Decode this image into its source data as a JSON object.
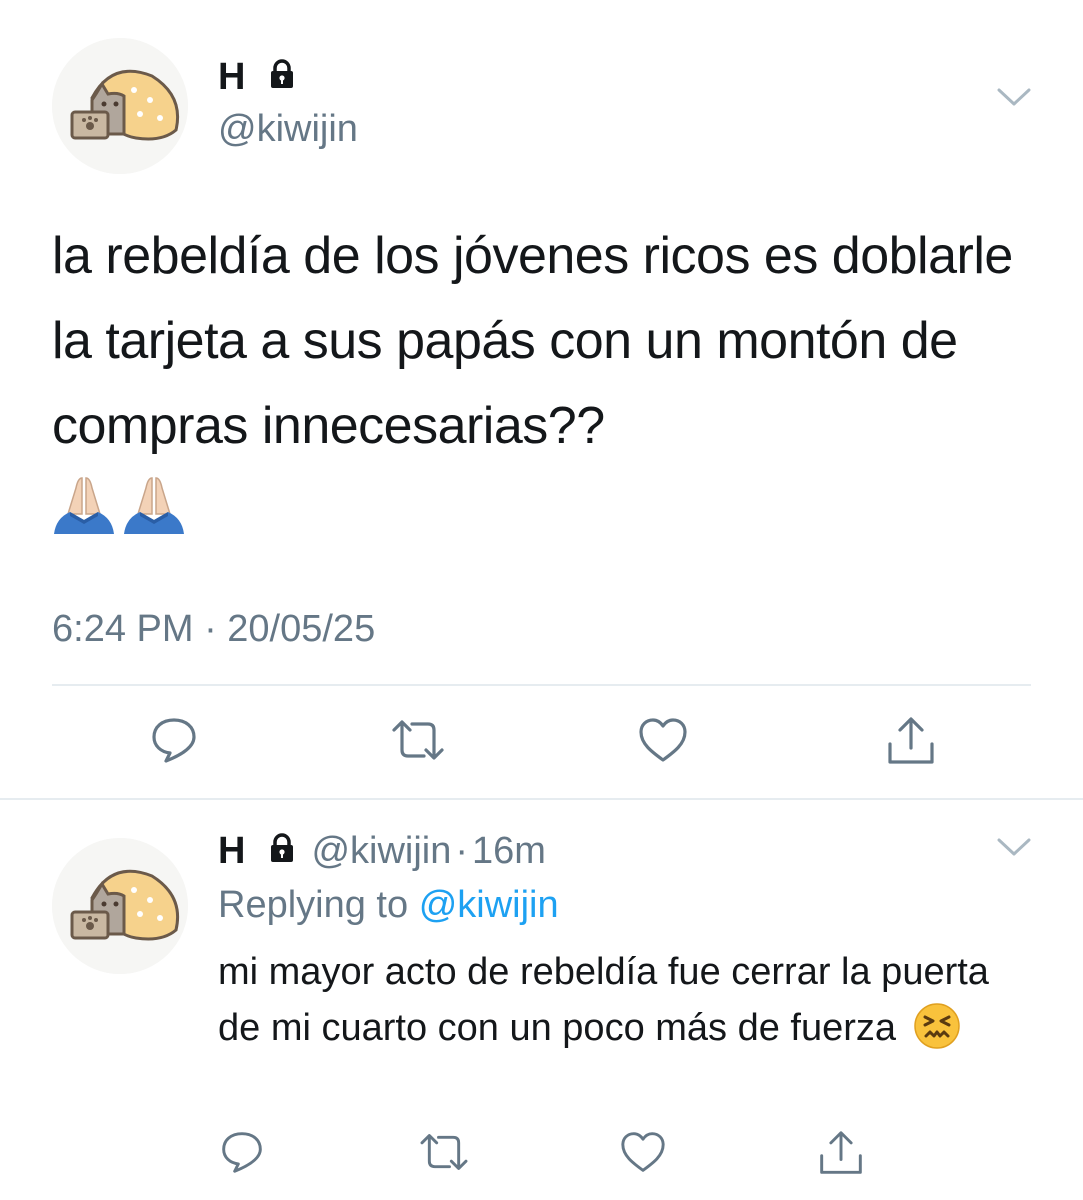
{
  "main_tweet": {
    "display_name": "H",
    "handle": "@kiwijin",
    "text": "la rebeldía de los jóvenes ricos es doblarle la tarjeta a sus papás con un montón de compras innecesarias??",
    "emoji": [
      "🙏🏻",
      "🙏🏻"
    ],
    "timestamp": "6:24 PM · 20/05/25",
    "icons": {
      "lock": "lock-icon",
      "menu": "chevron-down-icon",
      "reply": "reply-icon",
      "retweet": "retweet-icon",
      "like": "heart-icon",
      "share": "share-icon"
    }
  },
  "reply_tweet": {
    "display_name": "H",
    "handle": "@kiwijin",
    "separator": "·",
    "time_ago": "16m",
    "replying_prefix": "Replying to",
    "replying_to": "@kiwijin",
    "text": "mi mayor acto de rebeldía fue cerrar la puerta de mi cuarto con un poco más de fuerza",
    "emoji": "😖"
  },
  "colors": {
    "text": "#14171a",
    "secondary": "#657786",
    "accent": "#1da1f2",
    "divider": "#e6ecf0",
    "icon": "#657786"
  }
}
